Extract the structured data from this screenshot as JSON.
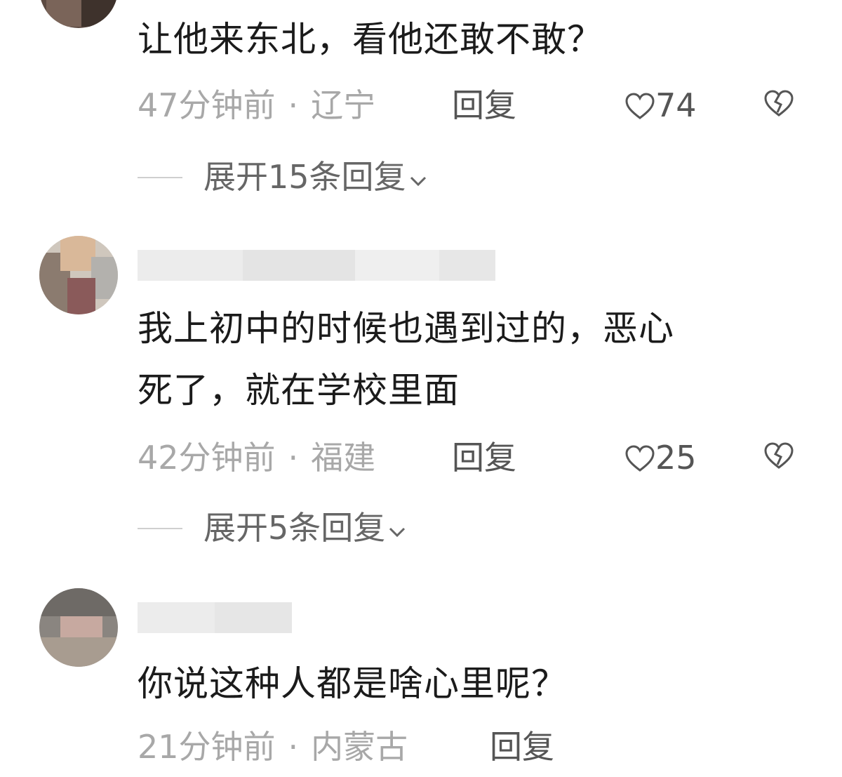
{
  "comments": [
    {
      "text": "让他来东北，看他还敢不敢？",
      "time": "47分钟前",
      "separator": "·",
      "location": "辽宁",
      "reply_label": "回复",
      "like_count": "74",
      "expand_label": "展开15条回复"
    },
    {
      "text_line1": "我上初中的时候也遇到过的，恶心",
      "text_line2": "死了，就在学校里面",
      "time": "42分钟前",
      "separator": "·",
      "location": "福建",
      "reply_label": "回复",
      "like_count": "25",
      "expand_label": "展开5条回复"
    },
    {
      "text": "你说这种人都是啥心里呢？",
      "time": "21分钟前",
      "separator": "·",
      "location": "内蒙古",
      "reply_label": "回复"
    }
  ],
  "icons": {
    "like": "heart-outline-icon",
    "dislike": "broken-heart-icon",
    "expand": "chevron-down-icon"
  },
  "colors": {
    "text": "#1b1b1b",
    "meta": "#a8a8a8",
    "action": "#555555"
  }
}
